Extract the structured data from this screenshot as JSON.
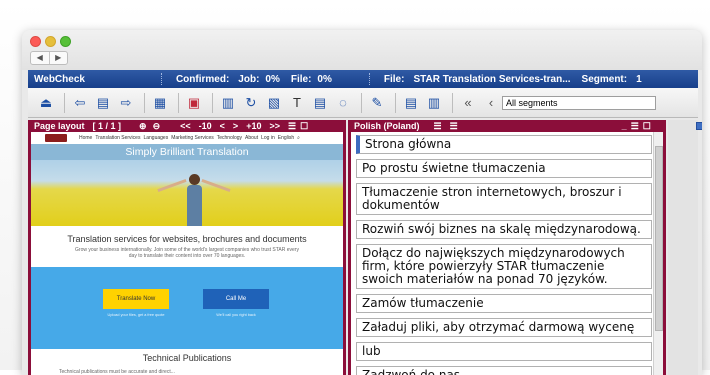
{
  "window": {
    "nav_back": "◀",
    "nav_forward": "▶"
  },
  "infobar": {
    "app": "WebCheck",
    "confirmed": "Confirmed:",
    "job": "Job:",
    "job_value": "0%",
    "file_label": "File:",
    "file_value": "0%",
    "file_name_label": "File:",
    "file_name": "STAR Translation Services-tran...",
    "segment_label": "Segment:",
    "segment_value": "1"
  },
  "toolbar": {
    "segments_select": "All segments",
    "icons": [
      "exit-icon",
      "back-icon",
      "translate-icon",
      "forward-icon",
      "save-icon",
      "insert-icon",
      "compare-icon",
      "refresh-icon",
      "pdf-icon",
      "text-icon",
      "comment-icon",
      "chat-icon",
      "tools-icon",
      "export-icon",
      "import-icon",
      "first-icon",
      "prev-icon"
    ]
  },
  "left_pane": {
    "title": "Page layout",
    "page": "[ 1 / 1 ]",
    "zoom_in": "⊕",
    "zoom_out": "⊖",
    "nav_first": "<<",
    "nav_minus10": "-10",
    "nav_prev": "<",
    "nav_next": ">",
    "nav_plus10": "+10",
    "nav_last": ">>",
    "site": {
      "nav_items": [
        "Home",
        "Translation Services",
        "Languages",
        "Marketing Services",
        "Technology",
        "About",
        "Log in",
        "English"
      ],
      "banner": "Simply Brilliant Translation",
      "heading": "Translation services for websites, brochures and documents",
      "sub": "Grow your business internationally. Join some of the world's largest companies who trust STAR every day to translate their content into over 70 languages.",
      "btn_translate": "Translate Now",
      "btn_call": "Call Me",
      "translate_sub": "Upload your files, get a free quote",
      "call_sub": "We'll call you right back",
      "tech_heading": "Technical Publications",
      "tech_sub": "Technical publications must be accurate and direct..."
    }
  },
  "right_pane": {
    "title": "Polish (Poland)",
    "segments": [
      "Strona główna",
      "Po prostu świetne tłumaczenia",
      "Tłumaczenie stron internetowych, broszur i dokumentów",
      "Rozwiń swój biznes na skalę międzynarodową.",
      "Dołącz do największych międzynarodowych firm, które powierzyły STAR tłumaczenie swoich materiałów na ponad 70 języków.",
      "Zamów tłumaczenie",
      "Załaduj pliki, aby otrzymać darmową wycenę",
      "lub",
      "Zadzwoń do nas"
    ]
  }
}
